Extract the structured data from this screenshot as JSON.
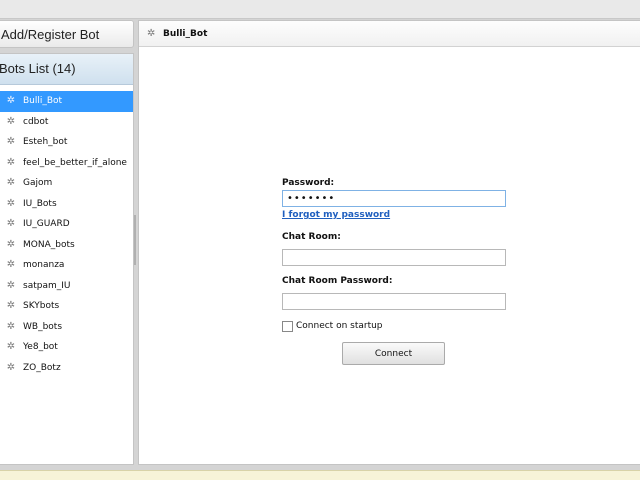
{
  "sidebar": {
    "add_register_label": "Add/Register Bot",
    "bots_list_header": "Bots List (14)",
    "bots": [
      {
        "name": "Bulli_Bot",
        "selected": true
      },
      {
        "name": "cdbot"
      },
      {
        "name": "Esteh_bot"
      },
      {
        "name": "feel_be_better_if_alone"
      },
      {
        "name": "Gajom"
      },
      {
        "name": "IU_Bots"
      },
      {
        "name": "IU_GUARD"
      },
      {
        "name": "MONA_bots"
      },
      {
        "name": "monanza"
      },
      {
        "name": "satpam_IU"
      },
      {
        "name": "SKYbots"
      },
      {
        "name": "WB_bots"
      },
      {
        "name": "Ye8_bot"
      },
      {
        "name": "ZO_Botz"
      }
    ],
    "bot_icon": "bot-icon",
    "selected_color": "#3399ff"
  },
  "main": {
    "tab_title": "Bulli_Bot",
    "form": {
      "password_label": "Password:",
      "password_value": "•••••••",
      "forgot_link": "I forgot my password",
      "chat_room_label": "Chat Room:",
      "chat_room_value": "",
      "chat_room_password_label": "Chat Room Password:",
      "chat_room_password_value": "",
      "connect_on_startup_label": "Connect on startup",
      "connect_on_startup_checked": false,
      "connect_button": "Connect"
    }
  }
}
